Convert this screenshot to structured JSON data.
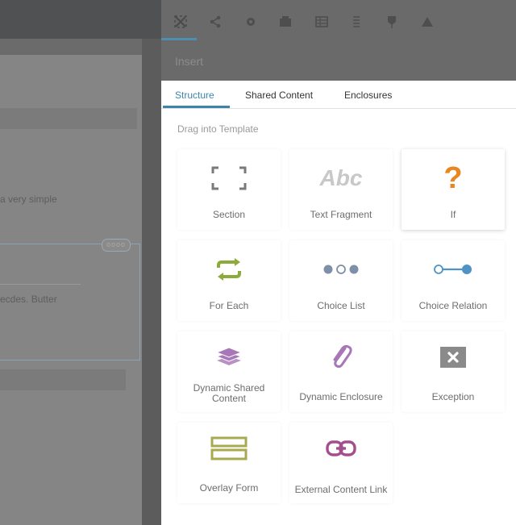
{
  "background": {
    "text1": "a very simple",
    "text2": "ecdes. Butter",
    "pill": "oooo"
  },
  "toolbar": {
    "icons": [
      "insert-icon",
      "share-icon",
      "settings-icon",
      "cube-icon",
      "table-icon",
      "list-icon",
      "pin-icon",
      "warning-icon"
    ]
  },
  "insert": {
    "title": "Insert"
  },
  "tabs": [
    "Structure",
    "Shared Content",
    "Enclosures"
  ],
  "hint": "Drag into Template",
  "tiles": [
    {
      "label": "Section",
      "icon": "section-icon"
    },
    {
      "label": "Text Fragment",
      "icon": "text-fragment-icon",
      "glyph": "Abc"
    },
    {
      "label": "If",
      "icon": "if-icon",
      "glyph": "?"
    },
    {
      "label": "For Each",
      "icon": "for-each-icon"
    },
    {
      "label": "Choice List",
      "icon": "choice-list-icon"
    },
    {
      "label": "Choice Relation",
      "icon": "choice-relation-icon"
    },
    {
      "label": "Dynamic Shared Content",
      "icon": "dynamic-shared-content-icon"
    },
    {
      "label": "Dynamic Enclosure",
      "icon": "dynamic-enclosure-icon"
    },
    {
      "label": "Exception",
      "icon": "exception-icon"
    },
    {
      "label": "Overlay Form",
      "icon": "overlay-form-icon"
    },
    {
      "label": "External Content Link",
      "icon": "external-content-link-icon"
    }
  ],
  "colors": {
    "accent": "#3d84a8",
    "orange": "#e88722",
    "green": "#8dab3a",
    "blue": "#4f93c4",
    "purple": "#a777b7",
    "olive": "#a8aa50",
    "gray_icon": "#8a8a8a"
  }
}
